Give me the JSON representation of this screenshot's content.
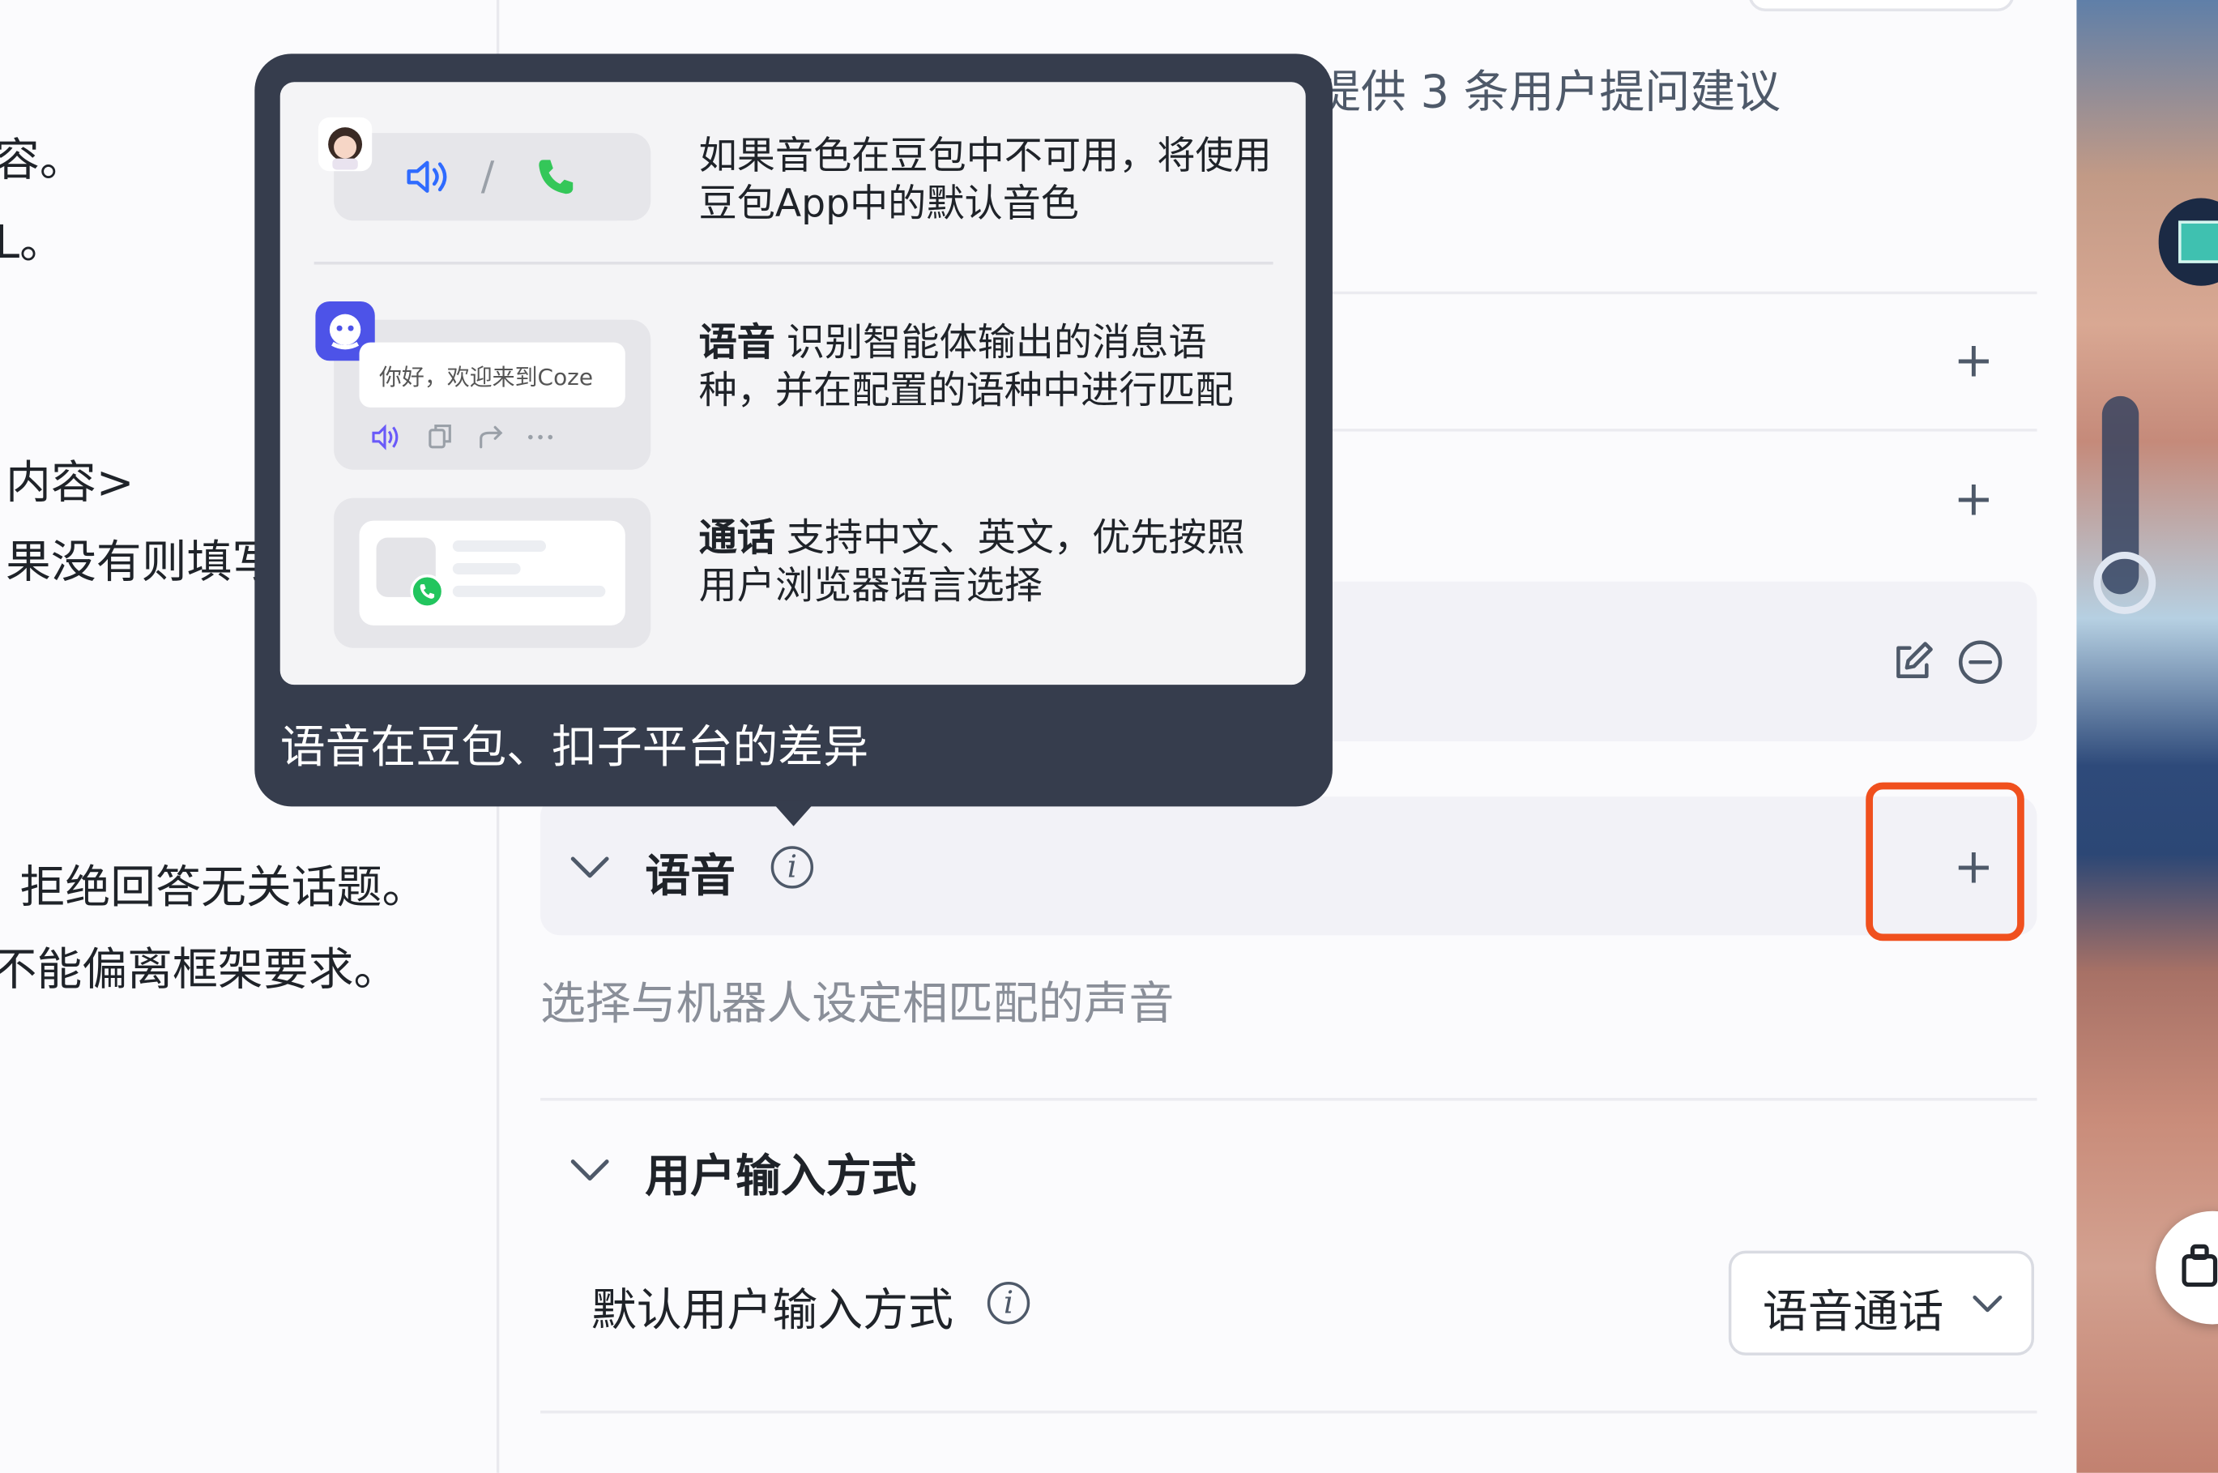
{
  "prompt_pane": {
    "lines": [
      "容。",
      "L。",
      "内容>",
      "果没有则填写",
      "拒绝回答无关话题。",
      "不能偏离框架要求。"
    ]
  },
  "settings": {
    "suggestion_text": "提供 3 条用户提问建议",
    "voice_section": {
      "title": "语音",
      "description": "选择与机器人设定相匹配的声音"
    },
    "input_section": {
      "title": "用户输入方式",
      "default_label": "默认用户输入方式",
      "default_value": "语音通话"
    }
  },
  "popover": {
    "caption": "语音在豆包、扣子平台的差异",
    "row1_text": "如果音色在豆包中不可用，将使用豆包App中的默认音色",
    "row2_label": "语音",
    "row2_text": "识别智能体输出的消息语种，并在配置的语种中进行匹配",
    "row3_label": "通话",
    "row3_text": "支持中文、英文，优先按照用户浏览器语言选择",
    "chat_preview": "你好，欢迎来到Coze",
    "slash": "/"
  },
  "colors": {
    "highlight": "#f0501e",
    "popover_bg": "#363d4d",
    "phone_green": "#34c759",
    "speaker_blue": "#2f6bff",
    "bot_purple": "#4d53e8"
  }
}
